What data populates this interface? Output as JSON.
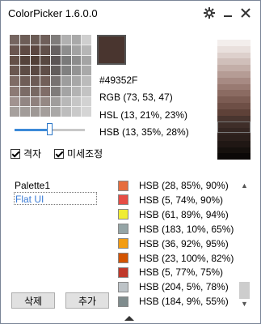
{
  "window": {
    "title": "ColorPicker  1.6.0.0"
  },
  "titlebar_icons": [
    "gear-icon",
    "minimize-icon",
    "close-icon"
  ],
  "grid_colors": [
    [
      "#756560",
      "#6d5d57",
      "#6a5b55",
      "#6f5f5a",
      "#7f7c7b",
      "#b0b0b0",
      "#a9a9a9",
      "#cfcfcf"
    ],
    [
      "#6a5650",
      "#5e4a43",
      "#5b4740",
      "#61504a",
      "#666161",
      "#8d8d8d",
      "#a2a2a2",
      "#b6b6b6"
    ],
    [
      "#645048",
      "#55433b",
      "#524037",
      "#584841",
      "#5b5555",
      "#7a7a7a",
      "#8c8c8c",
      "#a4a4a4"
    ],
    [
      "#6a5750",
      "#5d4c45",
      "#5a4942",
      "#5f4e48",
      "#625d5c",
      "#808080",
      "#939393",
      "#a9a9a9"
    ],
    [
      "#7e6b65",
      "#6f5d57",
      "#6c5b55",
      "#725f59",
      "#777271",
      "#9d9d9d",
      "#a7a7a7",
      "#bbbbbb"
    ],
    [
      "#8c7a75",
      "#7b6b66",
      "#776862",
      "#806d68",
      "#7f7b7a",
      "#a4a4a4",
      "#b3b3b3",
      "#c3c3c3"
    ],
    [
      "#a19390",
      "#928683",
      "#8f817d",
      "#958884",
      "#a09d9c",
      "#b8b8b8",
      "#c6c6c6",
      "#d2d2d2"
    ],
    [
      "#a6a09d",
      "#a29c99",
      "#9e9895",
      "#a49e9b",
      "#aaa8a7",
      "#bdbdbd",
      "#c9c9c9",
      "#d5d5d5"
    ]
  ],
  "current": {
    "color": "#49352F",
    "hex": "#49352F",
    "rgb": "RGB (73, 53, 47)",
    "hsl": "HSL (13, 21%, 23%)",
    "hsb": "HSB (13, 35%, 28%)"
  },
  "slider": {
    "value_fraction": 0.5
  },
  "checkboxes": [
    {
      "label": "격자",
      "checked": true
    },
    {
      "label": "미세조정",
      "checked": true
    }
  ],
  "gradient_colors": [
    "#f3eeec",
    "#e9e0dd",
    "#ddd0cc",
    "#d0bfba",
    "#c3aea8",
    "#b59c95",
    "#a78a83",
    "#997a72",
    "#8b6b62",
    "#7c5c53",
    "#6e4f46",
    "#5e4138",
    "#49352f",
    "#3f2e29",
    "#352622",
    "#2b1f1b",
    "#201714",
    "#15100d",
    "#0b0807"
  ],
  "palettes": [
    "Palette1",
    "Flat UI"
  ],
  "palette_selected": 1,
  "colors": [
    {
      "swatch": "#e66d3e",
      "label": "HSB (28, 85%, 90%)"
    },
    {
      "swatch": "#e64d45",
      "label": "HSB (5, 74%, 90%)"
    },
    {
      "swatch": "#f0ed33",
      "label": "HSB (61, 89%, 94%)"
    },
    {
      "swatch": "#95a5a6",
      "label": "HSB (183, 10%, 65%)"
    },
    {
      "swatch": "#f39c12",
      "label": "HSB (36, 92%, 95%)"
    },
    {
      "swatch": "#d35400",
      "label": "HSB (23, 100%, 82%)"
    },
    {
      "swatch": "#c0392b",
      "label": "HSB (5, 77%, 75%)"
    },
    {
      "swatch": "#bdc3c7",
      "label": "HSB (204, 5%, 78%)"
    },
    {
      "swatch": "#7f8c8d",
      "label": "HSB (184, 9%, 55%)"
    }
  ],
  "buttons": {
    "delete": "삭제",
    "add": "추가"
  }
}
